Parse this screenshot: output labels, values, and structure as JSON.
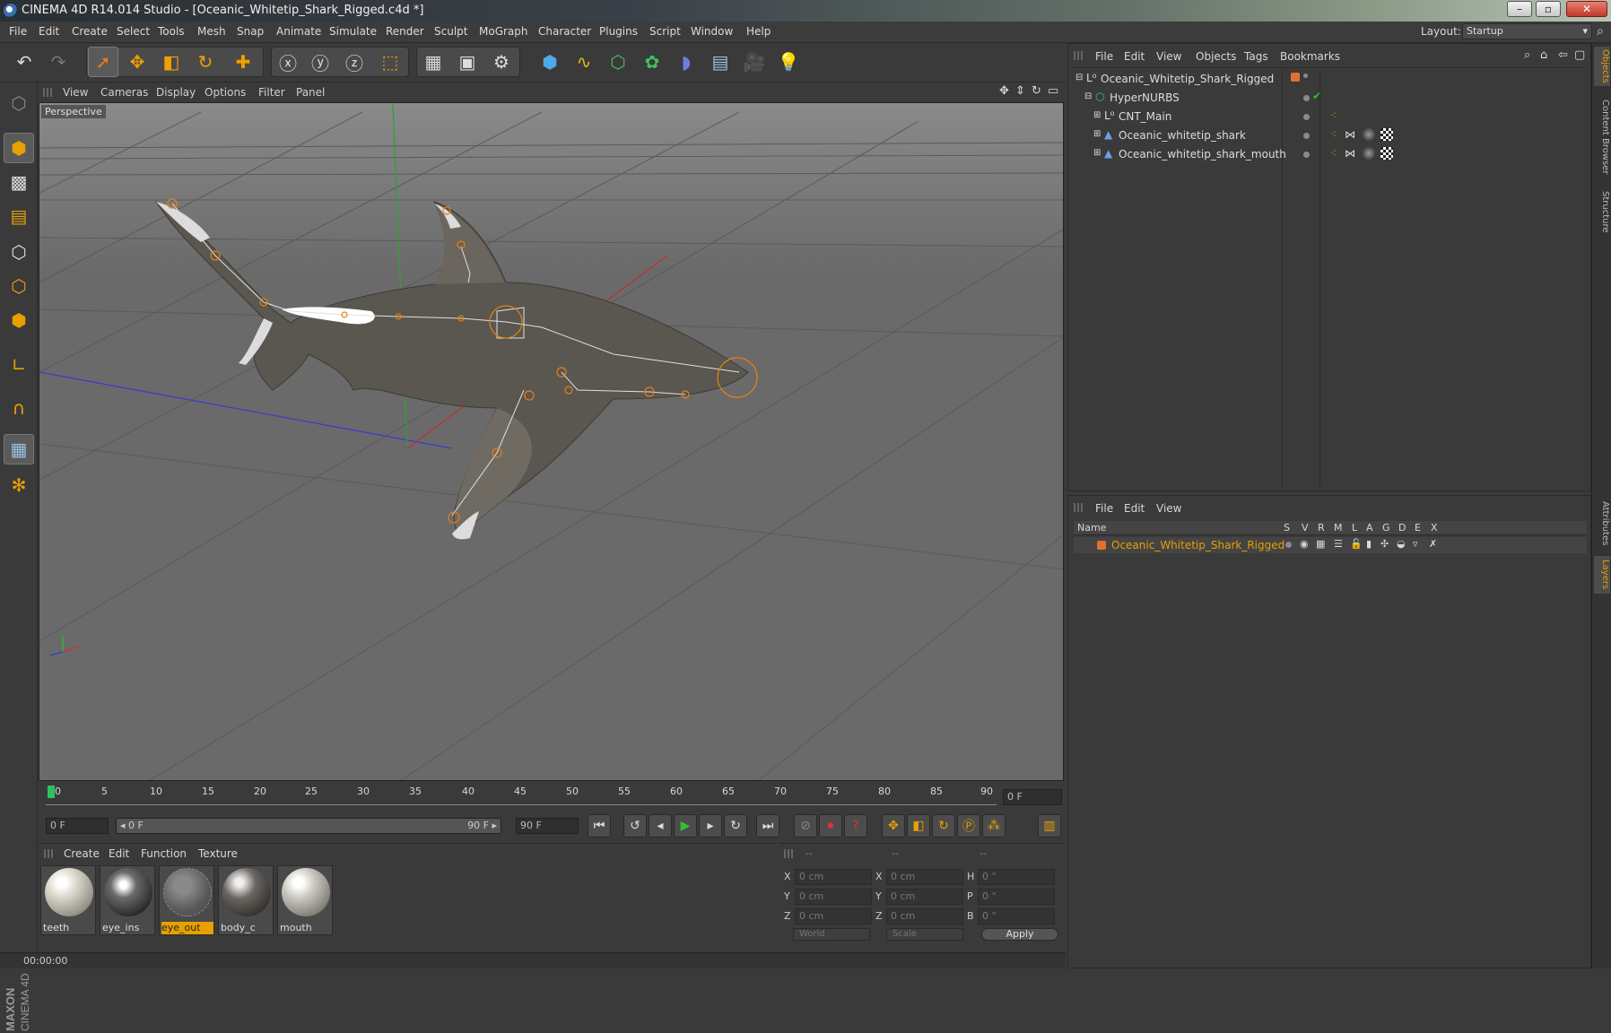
{
  "window": {
    "title": "CINEMA 4D R14.014 Studio - [Oceanic_Whitetip_Shark_Rigged.c4d *]",
    "minimize": "–",
    "maximize": "▫",
    "close": "✕"
  },
  "menubar": {
    "items": [
      "File",
      "Edit",
      "Create",
      "Select",
      "Tools",
      "Mesh",
      "Snap",
      "Animate",
      "Simulate",
      "Render",
      "Sculpt",
      "MoGraph",
      "Character",
      "Plugins",
      "Script",
      "Window",
      "Help"
    ],
    "layout_label": "Layout:",
    "layout_value": "Startup"
  },
  "viewport": {
    "menu": [
      "View",
      "Cameras",
      "Display",
      "Options",
      "Filter",
      "Panel"
    ],
    "label": "Perspective"
  },
  "timeline": {
    "ticks": [
      "0",
      "5",
      "10",
      "15",
      "20",
      "25",
      "30",
      "35",
      "40",
      "45",
      "50",
      "55",
      "60",
      "65",
      "70",
      "75",
      "80",
      "85",
      "90"
    ],
    "current_frame": "0 F",
    "start_field": "0 F",
    "range_start": "◂ 0 F",
    "range_end": "90 F ▸",
    "end_field": "90 F"
  },
  "material_manager": {
    "menu": [
      "Create",
      "Edit",
      "Function",
      "Texture"
    ],
    "materials": [
      {
        "name": "teeth",
        "selected": false
      },
      {
        "name": "eye_ins",
        "selected": false
      },
      {
        "name": "eye_out",
        "selected": true
      },
      {
        "name": "body_c",
        "selected": false
      },
      {
        "name": "mouth",
        "selected": false
      }
    ]
  },
  "coordinates": {
    "headers": [
      "--",
      "--",
      "--"
    ],
    "rows": [
      {
        "a": "X",
        "av": "0 cm",
        "b": "X",
        "bv": "0 cm",
        "c": "H",
        "cv": "0 °"
      },
      {
        "a": "Y",
        "av": "0 cm",
        "b": "Y",
        "bv": "0 cm",
        "c": "P",
        "cv": "0 °"
      },
      {
        "a": "Z",
        "av": "0 cm",
        "b": "Z",
        "bv": "0 cm",
        "c": "B",
        "cv": "0 °"
      }
    ],
    "world": "World",
    "scale": "Scale",
    "apply": "Apply"
  },
  "status": {
    "time": "00:00:00"
  },
  "object_manager": {
    "menu": [
      "File",
      "Edit",
      "View",
      "Objects",
      "Tags",
      "Bookmarks"
    ],
    "objects": [
      {
        "name": "Oceanic_Whitetip_Shark_Rigged",
        "indent": 0,
        "icon": "null-icon"
      },
      {
        "name": "HyperNURBS",
        "indent": 1,
        "icon": "hypernurbs-icon"
      },
      {
        "name": "CNT_Main",
        "indent": 2,
        "icon": "null-icon"
      },
      {
        "name": "Oceanic_whitetip_shark",
        "indent": 2,
        "icon": "polygon-object-icon"
      },
      {
        "name": "Oceanic_whitetip_shark_mouth",
        "indent": 2,
        "icon": "polygon-object-icon"
      }
    ]
  },
  "layer_manager": {
    "menu": [
      "File",
      "Edit",
      "View"
    ],
    "columns": [
      "Name",
      "S",
      "V",
      "R",
      "M",
      "L",
      "A",
      "G",
      "D",
      "E",
      "X"
    ],
    "layers": [
      {
        "name": "Oceanic_Whitetip_Shark_Rigged",
        "color": "#e07030"
      }
    ]
  },
  "side_tabs": [
    "Objects",
    "Content Browser",
    "Structure",
    "Attributes",
    "Layers"
  ],
  "brand": {
    "maxon": "MAXON",
    "product": "CINEMA 4D"
  },
  "colors": {
    "accent": "#e8a000",
    "selection": "#f08010"
  }
}
